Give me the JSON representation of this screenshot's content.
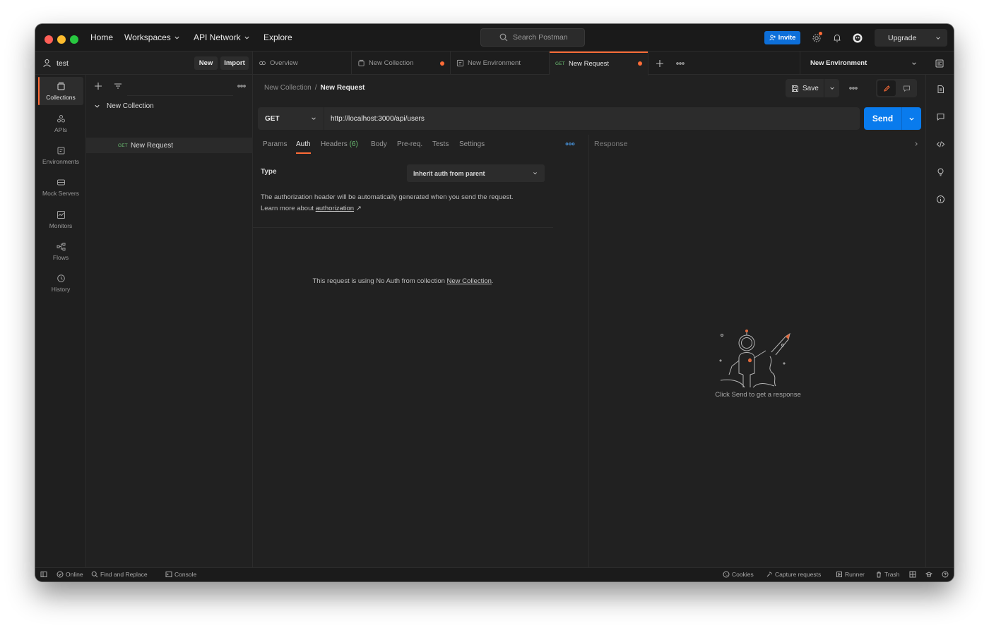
{
  "nav": {
    "home": "Home",
    "workspaces": "Workspaces",
    "api_network": "API Network",
    "explore": "Explore",
    "search_placeholder": "Search Postman",
    "invite": "Invite",
    "upgrade": "Upgrade"
  },
  "workspace": {
    "name": "test",
    "new_label": "New",
    "import_label": "Import"
  },
  "rail": [
    {
      "label": "Collections",
      "icon": "collections-icon"
    },
    {
      "label": "APIs",
      "icon": "apis-icon"
    },
    {
      "label": "Environments",
      "icon": "environments-icon"
    },
    {
      "label": "Mock Servers",
      "icon": "mock-servers-icon"
    },
    {
      "label": "Monitors",
      "icon": "monitors-icon"
    },
    {
      "label": "Flows",
      "icon": "flows-icon"
    },
    {
      "label": "History",
      "icon": "history-icon"
    }
  ],
  "sidebar": {
    "collection": "New Collection",
    "request_method": "GET",
    "request_name": "New Request"
  },
  "tabs": [
    {
      "label": "Overview"
    },
    {
      "label": "New Collection"
    },
    {
      "label": "New Environment"
    },
    {
      "method": "GET",
      "label": "New Request"
    }
  ],
  "environment": "New Environment",
  "request": {
    "breadcrumb_parent": "New Collection",
    "breadcrumb_sep": "/",
    "breadcrumb_current": "New Request",
    "save_label": "Save",
    "method": "GET",
    "url": "http://localhost:3000/api/users",
    "send_label": "Send"
  },
  "req_tabs": {
    "params": "Params",
    "auth": "Auth",
    "headers": "Headers",
    "headers_count": "(6)",
    "body": "Body",
    "prereq": "Pre-req.",
    "tests": "Tests",
    "settings": "Settings"
  },
  "auth": {
    "type_label": "Type",
    "type_value": "Inherit auth from parent",
    "desc_prefix": "The authorization header will be automatically generated when you send the request. Learn more about ",
    "desc_link": "authorization",
    "desc_arrow": "↗",
    "noauth_prefix": "This request is using No Auth from collection ",
    "noauth_link": "New Collection",
    "noauth_suffix": "."
  },
  "response": {
    "title": "Response",
    "hint": "Click Send to get a response"
  },
  "statusbar": {
    "online": "Online",
    "find_replace": "Find and Replace",
    "console": "Console",
    "cookies": "Cookies",
    "capture": "Capture requests",
    "runner": "Runner",
    "trash": "Trash"
  },
  "colors": {
    "accent": "#ff6c37",
    "send_blue": "#097bed",
    "get_green": "#6bbf72"
  }
}
